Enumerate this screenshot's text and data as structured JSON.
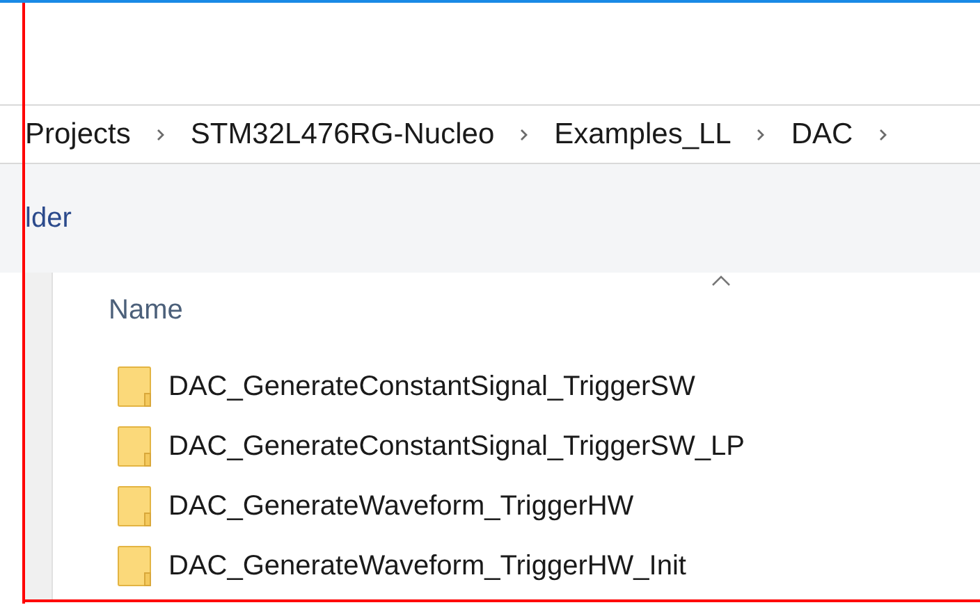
{
  "breadcrumb": [
    "Projects",
    "STM32L476RG-Nucleo",
    "Examples_LL",
    "DAC"
  ],
  "toolbar": {
    "label": "lder"
  },
  "file_list": {
    "columns": [
      "Name"
    ],
    "rows": [
      {
        "name": "DAC_GenerateConstantSignal_TriggerSW"
      },
      {
        "name": "DAC_GenerateConstantSignal_TriggerSW_LP"
      },
      {
        "name": "DAC_GenerateWaveform_TriggerHW"
      },
      {
        "name": "DAC_GenerateWaveform_TriggerHW_Init"
      }
    ]
  }
}
